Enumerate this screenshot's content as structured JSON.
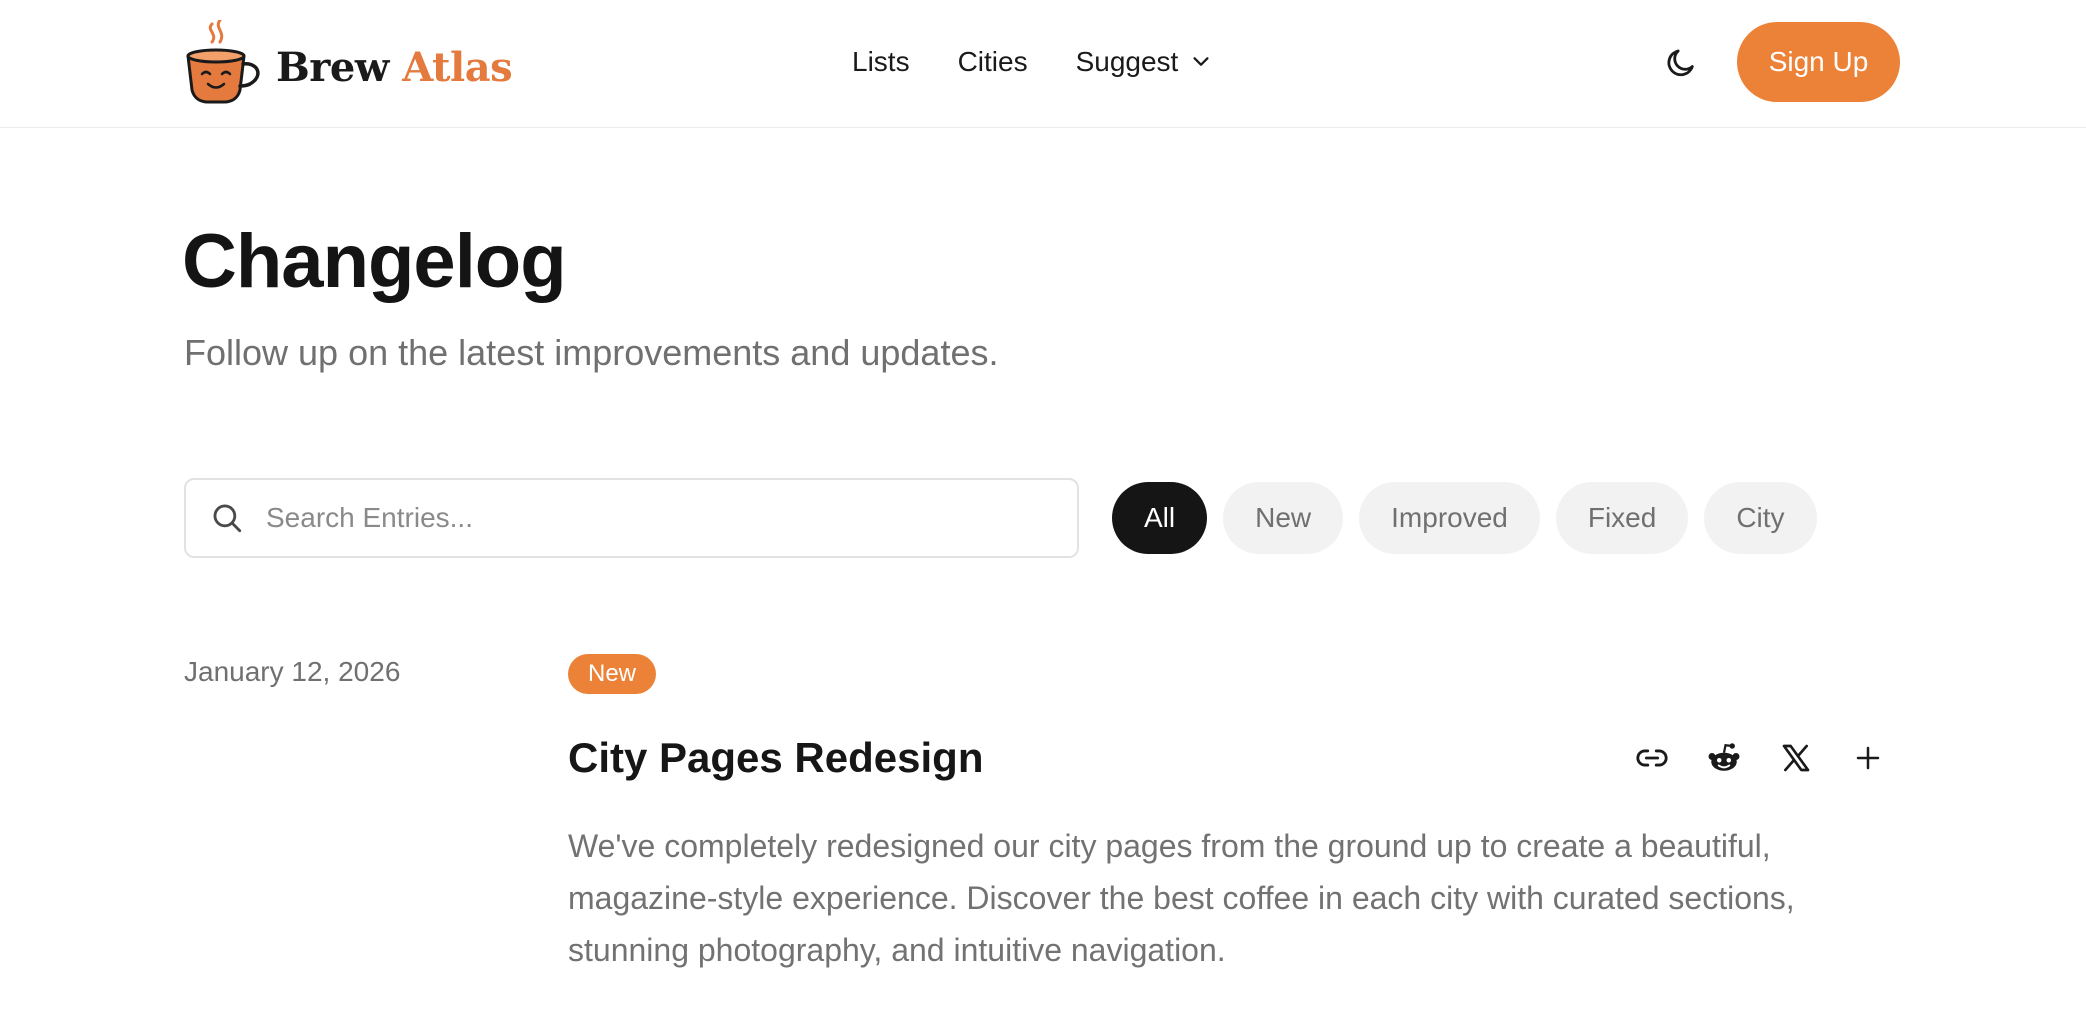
{
  "brand": {
    "name_part1": "Brew",
    "name_part2": "Atlas"
  },
  "nav": {
    "items": [
      "Lists",
      "Cities",
      "Suggest"
    ]
  },
  "header": {
    "signup_label": "Sign Up"
  },
  "page": {
    "title": "Changelog",
    "subtitle": "Follow up on the latest improvements and updates."
  },
  "search": {
    "placeholder": "Search Entries..."
  },
  "filters": [
    "All",
    "New",
    "Improved",
    "Fixed",
    "City"
  ],
  "entry": {
    "date": "January 12, 2026",
    "badge": "New",
    "title": "City Pages Redesign",
    "body": "We've completely redesigned our city pages from the ground up to create a beautiful, magazine-style experience. Discover the best coffee in each city with curated sections, stunning photography, and intuitive navigation."
  },
  "colors": {
    "accent": "#ec8238",
    "active_chip": "#151515",
    "muted_text": "#707070"
  },
  "icons": [
    "coffee-cup-logo-icon",
    "chevron-down-icon",
    "moon-icon",
    "search-icon",
    "link-icon",
    "reddit-icon",
    "x-icon",
    "plus-icon"
  ]
}
